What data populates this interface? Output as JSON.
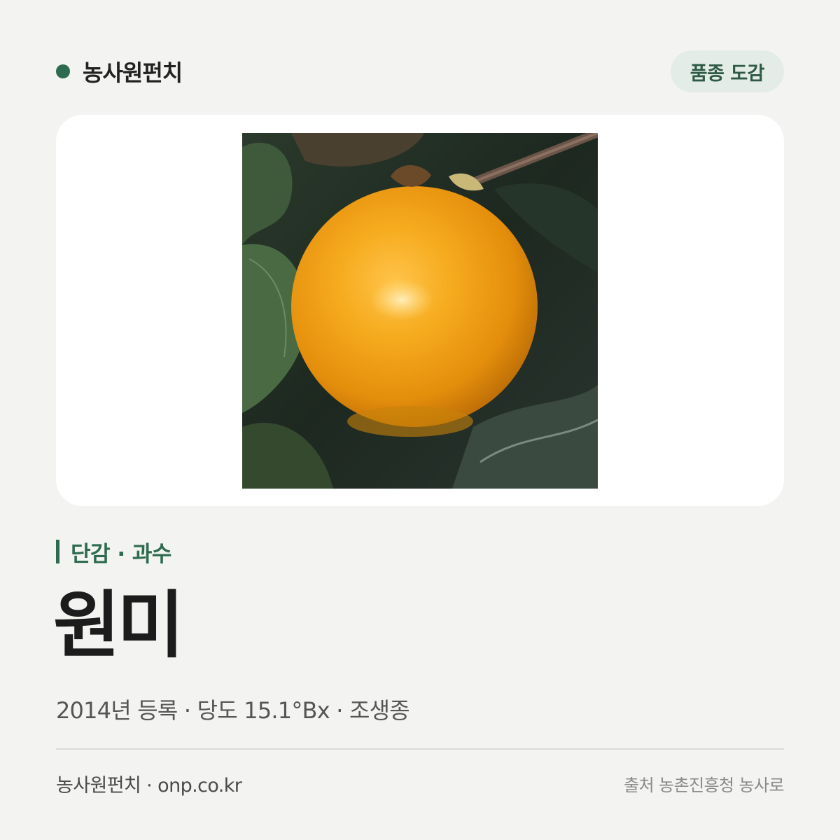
{
  "header": {
    "brand_name": "농사원펀치",
    "badge_label": "품종 도감"
  },
  "colors": {
    "brand_green": "#2e6b4e",
    "badge_bg": "#e4ece7",
    "background": "#f3f3f1",
    "fruit_orange": "#f0a218"
  },
  "variety": {
    "category": "단감 · 과수",
    "name": "원미",
    "details": "2014년 등록 · 당도 15.1°Bx · 조생종",
    "image_alt": "원미"
  },
  "footer": {
    "left_text": "농사원펀치 · onp.co.kr",
    "source_text": "출처 농촌진흥청 농사로"
  }
}
